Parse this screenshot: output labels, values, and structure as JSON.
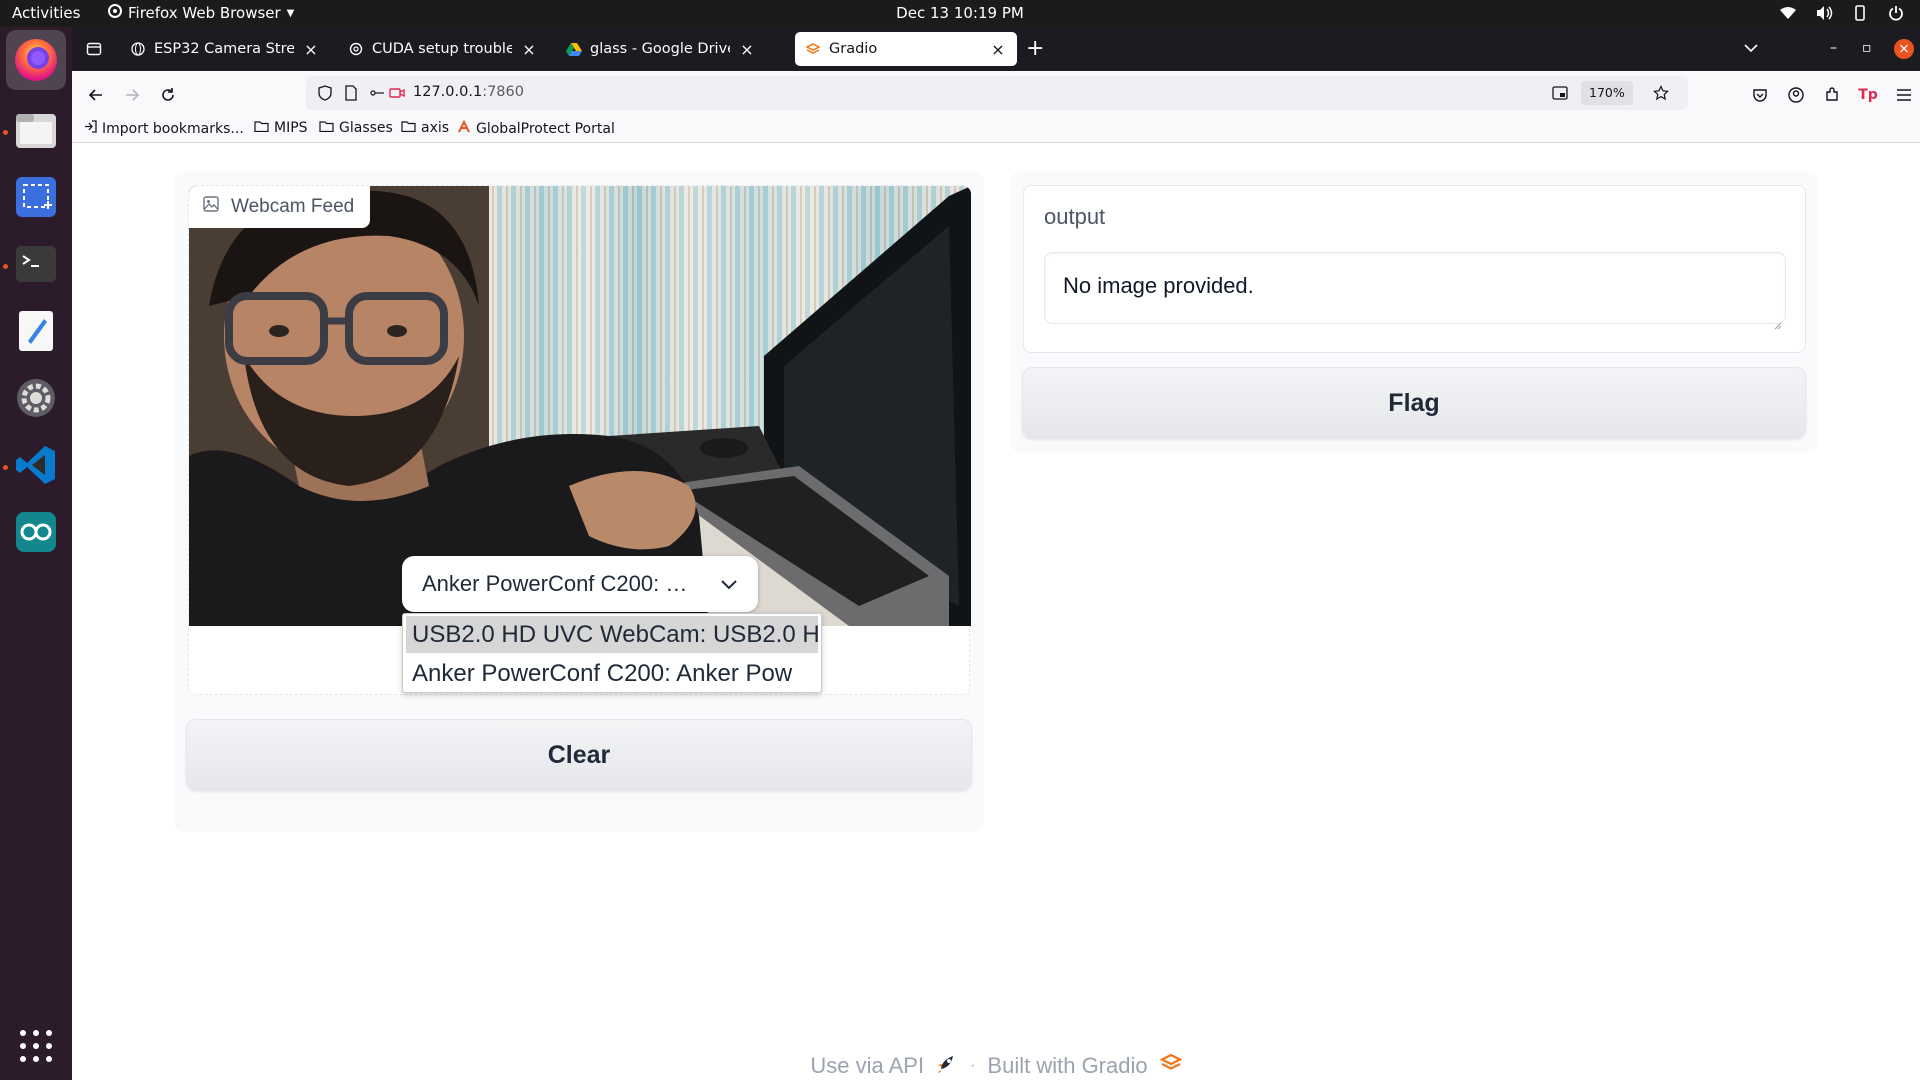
{
  "system": {
    "activities": "Activities",
    "app_menu": "Firefox Web Browser",
    "clock": "Dec 13  10:19 PM"
  },
  "dock": {
    "items": [
      "firefox-icon",
      "files-icon",
      "screenshot-icon",
      "terminal-icon",
      "text-editor-icon",
      "settings-icon",
      "vscode-icon",
      "arduino-icon"
    ],
    "show_apps_icon": "app-grid-icon"
  },
  "browser": {
    "tabs": [
      {
        "title": "ESP32 Camera Stream S",
        "active": false
      },
      {
        "title": "CUDA setup troubleshoo",
        "active": false
      },
      {
        "title": "glass - Google Drive",
        "active": false
      },
      {
        "title": "Gradio",
        "active": true
      }
    ],
    "url_host": "127.0.0.1",
    "url_port": ":7860",
    "zoom": "170%",
    "bookmarks": [
      "Import bookmarks...",
      "MIPS",
      "Glasses",
      "axis",
      "GlobalProtect Portal"
    ]
  },
  "app": {
    "input": {
      "label": "Webcam Feed",
      "selected_device": "Anker PowerConf C200: …",
      "device_options": [
        "USB2.0 HD UVC WebCam: USB2.0 HD",
        "Anker PowerConf C200: Anker Pow"
      ]
    },
    "clear_label": "Clear",
    "output": {
      "label": "output",
      "value": "No image provided."
    },
    "flag_label": "Flag",
    "footer": {
      "api": "Use via API",
      "separator": "·",
      "built_with": "Built with Gradio"
    }
  },
  "colors": {
    "accent_orange": "#f97316",
    "ubuntu_orange": "#e95420"
  }
}
